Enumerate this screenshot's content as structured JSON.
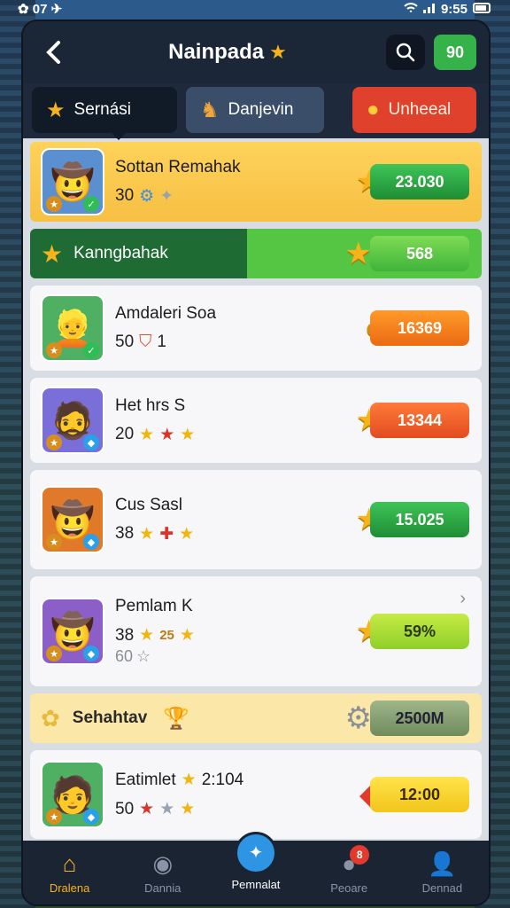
{
  "status_bar": {
    "left": "✿ 07 ✈",
    "right": "9:55"
  },
  "header": {
    "title": "Nainpada"
  },
  "header_coin": "90",
  "tabs": [
    {
      "label": "Sernási"
    },
    {
      "label": "Danjevin"
    },
    {
      "label": "Unheeal"
    }
  ],
  "rows": [
    {
      "name": "Sottan Remahak",
      "level": "30",
      "score": "23.030"
    },
    {
      "bar_label": "Kanngbahak",
      "score": "568"
    },
    {
      "name": "Amdaleri Soa",
      "level": "50",
      "extra": "1",
      "score": "16369"
    },
    {
      "name": "Het hrs S",
      "level": "20",
      "score": "13344"
    },
    {
      "name": "Cus Sasl",
      "level": "38",
      "score": "15.025"
    },
    {
      "name": "Pemlam K",
      "level": "38",
      "mid": "25",
      "sub": "60",
      "score": "59%"
    },
    {
      "cream_label": "Sehahtav",
      "score": "2500M"
    },
    {
      "name": "Eatimlet",
      "name_extra": "2:104",
      "level": "50",
      "score": "12:00"
    }
  ],
  "bottom_nav": [
    {
      "label": "Dralena"
    },
    {
      "label": "Dannia"
    },
    {
      "label": "Pemnalat"
    },
    {
      "label": "Peoare",
      "badge": "8"
    },
    {
      "label": "Dennad"
    }
  ]
}
